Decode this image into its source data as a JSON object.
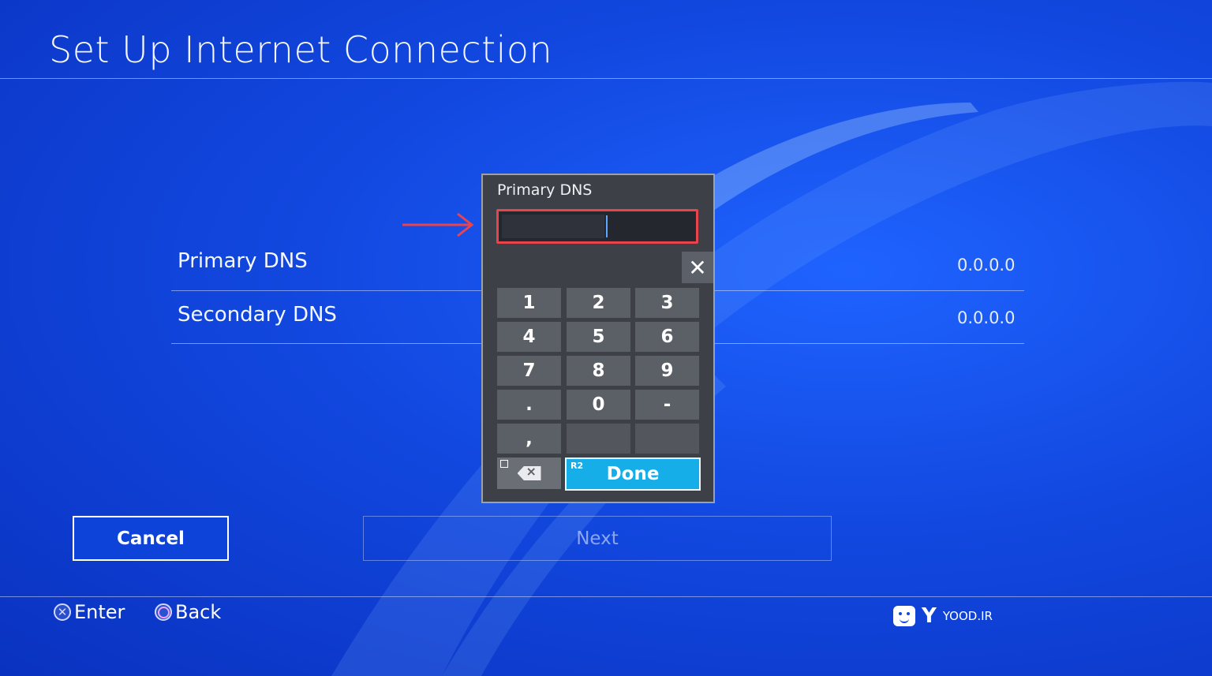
{
  "header": {
    "title": "Set Up Internet Connection"
  },
  "settings": {
    "rows": [
      {
        "label": "Primary DNS",
        "value": "0.0.0.0"
      },
      {
        "label": "Secondary DNS",
        "value": "0.0.0.0"
      }
    ]
  },
  "dialog": {
    "title": "Primary DNS",
    "input_value": "",
    "keys": [
      "1",
      "2",
      "3",
      "4",
      "5",
      "6",
      "7",
      "8",
      "9",
      ".",
      "0",
      "-",
      ",",
      "",
      ""
    ],
    "r2_label": "R2",
    "done_label": "Done"
  },
  "buttons": {
    "cancel": "Cancel",
    "next": "Next"
  },
  "footer": {
    "enter_label": "Enter",
    "back_label": "Back",
    "watermark": "YOOD.IR",
    "watermark_y": "Y"
  },
  "colors": {
    "background": "#1248e0",
    "accent_done": "#16aee8",
    "highlight": "#e8444d"
  }
}
